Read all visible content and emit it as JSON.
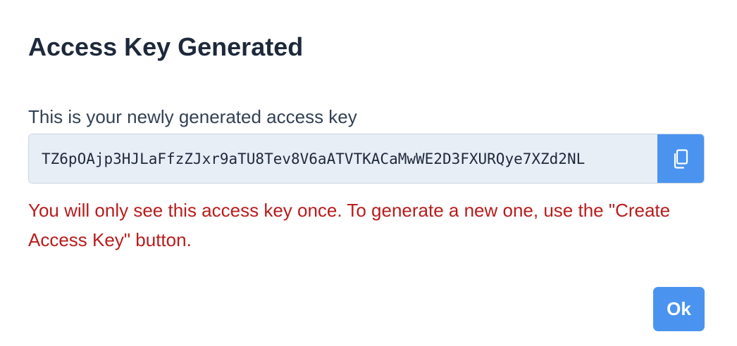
{
  "dialog": {
    "title": "Access Key Generated",
    "field_label": "This is your newly generated access key",
    "access_key": "TZ6pOAjp3HJLaFfzZJxr9aTU8Tev8V6aATVTKACaMwWE2D3FXURQye7XZd2NL",
    "copy_icon": "copy-icon",
    "warning": "You will only see this access key once. To generate a new one, use the \"Create Access Key\" button.",
    "ok_label": "Ok"
  },
  "colors": {
    "title": "#1e293b",
    "warning": "#b91c1c",
    "accent": "#4a94f0",
    "input_bg": "#e8eef6"
  }
}
